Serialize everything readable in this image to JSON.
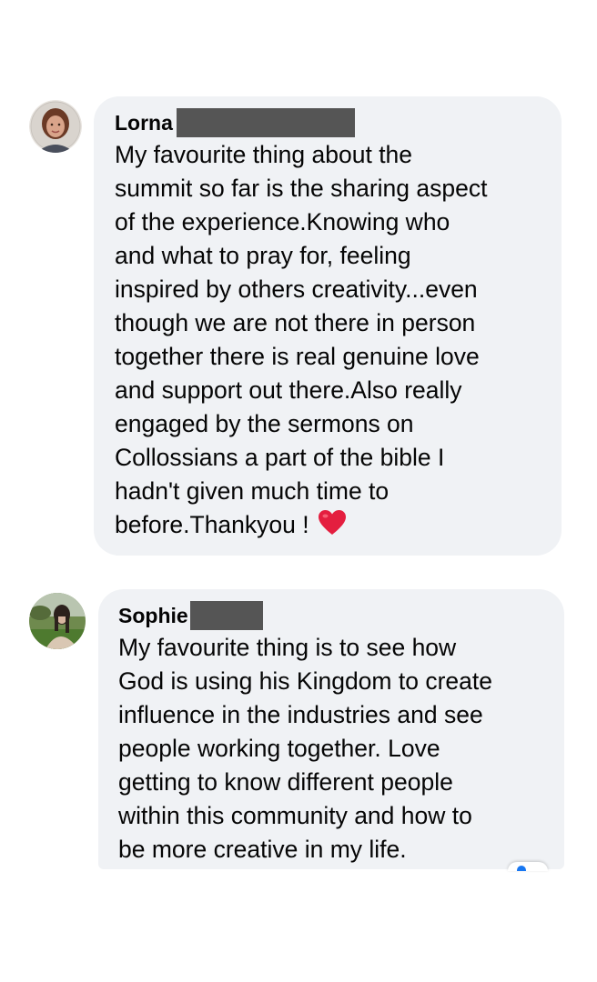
{
  "comments": [
    {
      "author": "Lorna",
      "text_lines": [
        "My favourite thing about the",
        "summit so far is the sharing aspect",
        "of the experience.Knowing who",
        "and what to pray for, feeling",
        "inspired by others creativity...even",
        "though we are not there in person",
        "together there is real genuine love",
        "and support out there.Also really",
        "engaged by the sermons on",
        "Collossians a part of the bible I",
        "hadn't given much time to",
        "before.Thankyou !"
      ],
      "reaction_icon": "red-heart-emoji",
      "avatar_icon": "user-avatar-photo"
    },
    {
      "author": "Sophie",
      "text_lines": [
        "My favourite thing is to see how",
        "God is using his Kingdom to create",
        "influence in the industries and see",
        "people working together. Love",
        "getting to know different people",
        "within this community and how to",
        "be more creative in my life."
      ],
      "avatar_icon": "user-avatar-photo"
    }
  ],
  "colors": {
    "bubble_background": "#f0f2f5",
    "redaction": "#555555",
    "heart": "#e41e3f",
    "text": "#050505"
  }
}
